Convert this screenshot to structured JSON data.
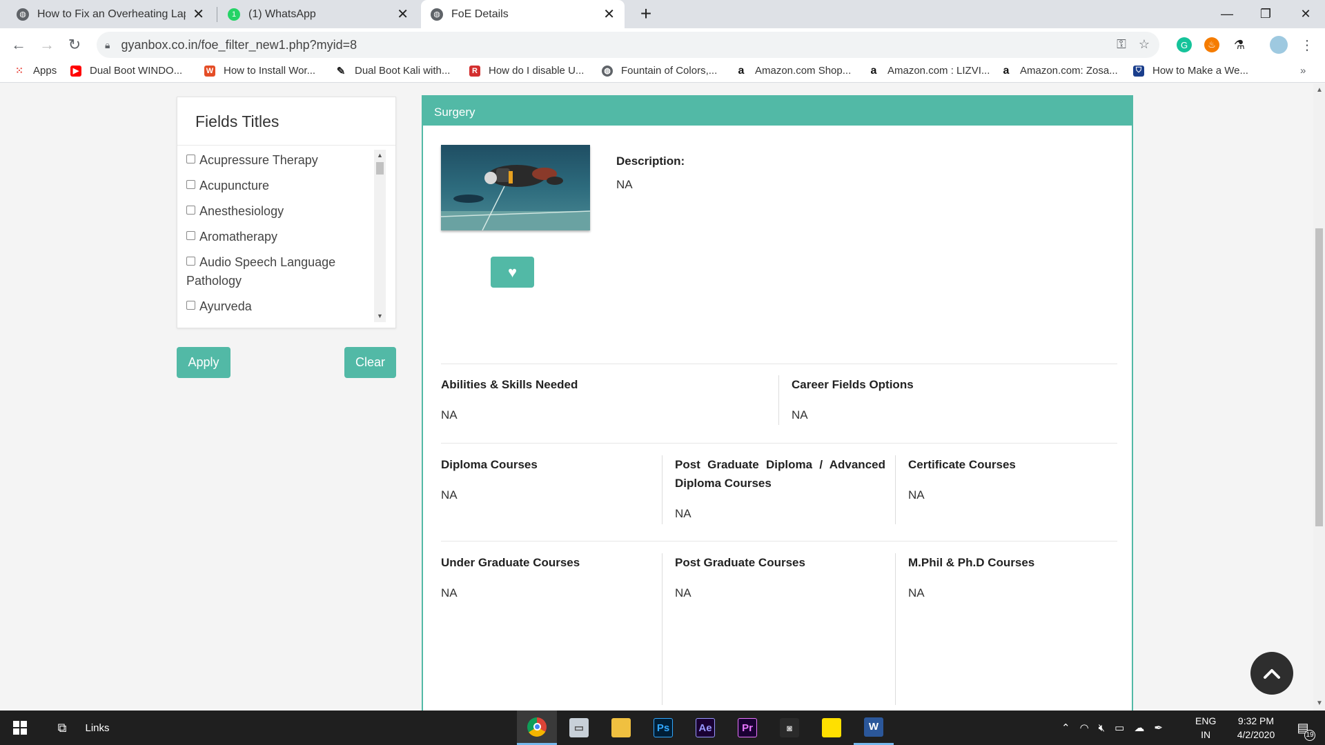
{
  "browser": {
    "tabs": [
      {
        "title": "How to Fix an Overheating Lapto",
        "icon": "globe-icon"
      },
      {
        "title": "(1) WhatsApp",
        "icon": "whatsapp-icon"
      },
      {
        "title": "FoE Details",
        "icon": "globe-icon"
      }
    ],
    "url": "gyanbox.co.in/foe_filter_new1.php?myid=8"
  },
  "bookmarks": [
    {
      "label": "Apps",
      "icon": "apps-grid-icon"
    },
    {
      "label": "Dual Boot WINDO...",
      "icon": "youtube-icon"
    },
    {
      "label": "How to Install Wor...",
      "icon": "bookmark-w-icon"
    },
    {
      "label": "Dual Boot Kali with...",
      "icon": "kali-icon"
    },
    {
      "label": "How do I disable U...",
      "icon": "bookmark-red-icon"
    },
    {
      "label": "Fountain of Colors,...",
      "icon": "globe-icon"
    },
    {
      "label": "Amazon.com Shop...",
      "icon": "amazon-icon"
    },
    {
      "label": "Amazon.com : LIZVI...",
      "icon": "amazon-icon"
    },
    {
      "label": "Amazon.com: Zosa...",
      "icon": "amazon-icon"
    },
    {
      "label": "How to Make a We...",
      "icon": "shield-icon"
    }
  ],
  "filter": {
    "title": "Fields Titles",
    "items": [
      "Acupressure Therapy",
      "Acupuncture",
      "Anesthesiology",
      "Aromatherapy",
      "Audio Speech Language Pathology",
      "Ayurveda"
    ],
    "apply_label": "Apply",
    "clear_label": "Clear"
  },
  "details": {
    "header": "Surgery",
    "description_label": "Description:",
    "description_value": "NA",
    "sections": [
      {
        "title": "Abilities & Skills Needed",
        "value": "NA"
      },
      {
        "title": "Career Fields Options",
        "value": "NA"
      },
      {
        "title": "Diploma Courses",
        "value": "NA"
      },
      {
        "title": "Post Graduate Diploma / Advanced Diploma Courses",
        "value": "NA"
      },
      {
        "title": "Certificate Courses",
        "value": "NA"
      },
      {
        "title": "Under Graduate Courses",
        "value": "NA"
      },
      {
        "title": "Post Graduate Courses",
        "value": "NA"
      },
      {
        "title": "M.Phil & Ph.D Courses",
        "value": "NA"
      }
    ]
  },
  "taskbar": {
    "links_label": "Links",
    "lang": "ENG",
    "region": "IN",
    "time": "9:32 PM",
    "date": "4/2/2020",
    "notification_count": "19",
    "apps": [
      {
        "name": "chrome-icon",
        "label": ""
      },
      {
        "name": "unknown-app-icon",
        "label": ""
      },
      {
        "name": "file-explorer-icon",
        "label": ""
      },
      {
        "name": "photoshop-icon",
        "label": "Ps"
      },
      {
        "name": "after-effects-icon",
        "label": "Ae"
      },
      {
        "name": "premiere-icon",
        "label": "Pr"
      },
      {
        "name": "media-encoder-icon",
        "label": ""
      },
      {
        "name": "sticky-notes-icon",
        "label": ""
      },
      {
        "name": "word-icon",
        "label": "W"
      }
    ]
  },
  "colors": {
    "accent": "#52b9a6",
    "tab_strip": "#dee1e6",
    "taskbar": "#1f1f1f"
  }
}
